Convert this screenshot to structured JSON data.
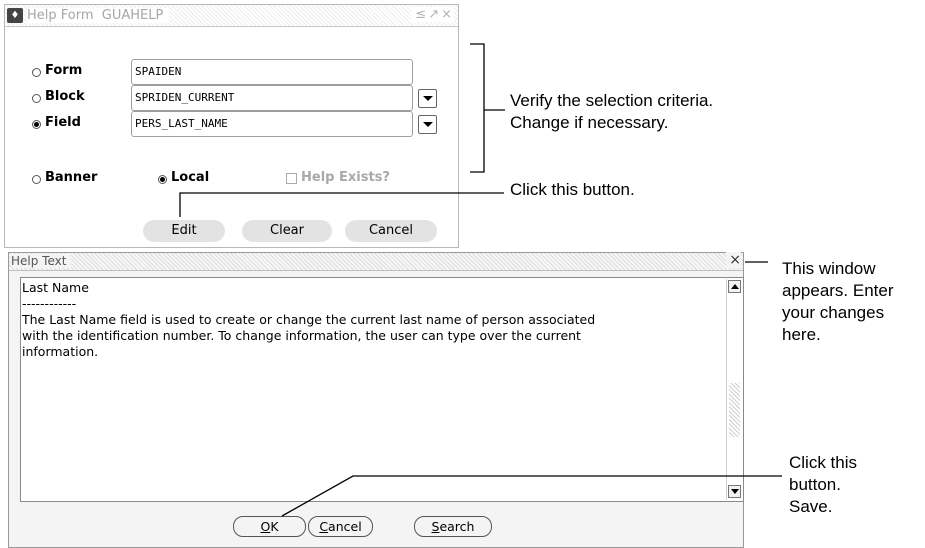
{
  "help_form": {
    "title": "Help Form  GUAHELP",
    "window_controls": [
      "≤",
      "↗",
      "×"
    ],
    "fields": [
      {
        "label": "Form",
        "value": "SPAIDEN",
        "selected": false,
        "has_dropdown": false
      },
      {
        "label": "Block",
        "value": "SPRIDEN_CURRENT",
        "selected": false,
        "has_dropdown": true
      },
      {
        "label": "Field",
        "value": "PERS_LAST_NAME",
        "selected": true,
        "has_dropdown": true
      }
    ],
    "scope": {
      "banner_label": "Banner",
      "local_label": "Local",
      "banner_selected": false,
      "local_selected": true
    },
    "help_exists_label": "Help Exists?",
    "help_exists_checked": false,
    "buttons": {
      "edit": "Edit",
      "clear": "Clear",
      "cancel": "Cancel"
    }
  },
  "help_text": {
    "title": "Help Text",
    "close_glyph": "×",
    "content": "Last Name\n------------\nThe Last Name field is used to create or change the current last name of person associated\nwith the identification number.  To change information, the user can type over the current\ninformation.",
    "buttons": {
      "ok": {
        "underlined": "O",
        "rest": "K"
      },
      "cancel": {
        "underlined": "C",
        "rest": "ancel"
      },
      "search": {
        "underlined": "S",
        "rest": "earch"
      }
    }
  },
  "annotations": {
    "verify": "Verify the selection criteria.\nChange if necessary.",
    "click_button": "Click this button.",
    "window_appears": "This window\nappears. Enter\nyour changes\nhere.",
    "click_save": "Click this\nbutton.\nSave."
  },
  "colors": {
    "title_text": "#a6a6a6",
    "pill_button": "#e3e3e3",
    "disabled_text": "#a9a9a9"
  }
}
